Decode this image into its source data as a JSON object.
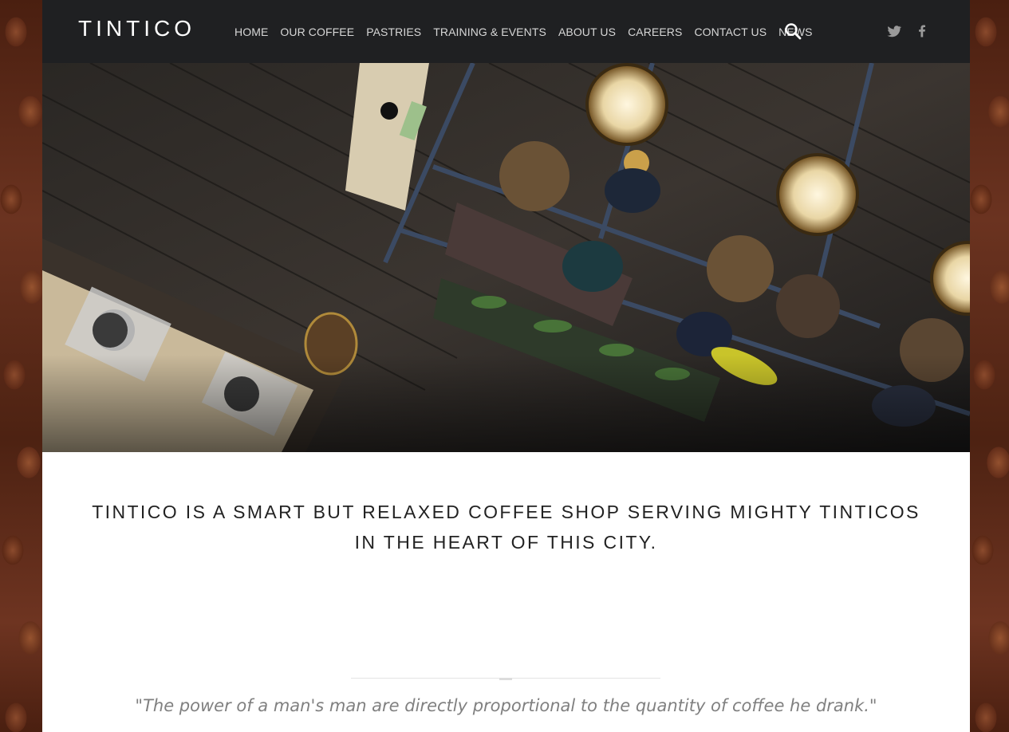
{
  "brand": {
    "logo_text": "TINTICO"
  },
  "nav": {
    "items": [
      "HOME",
      "OUR COFFEE",
      "PASTRIES",
      "TRAINING & EVENTS",
      "ABOUT US",
      "CAREERS",
      "CONTACT US",
      "NEWS"
    ]
  },
  "icons": {
    "search": "search-icon",
    "twitter": "twitter-icon",
    "facebook": "facebook-icon"
  },
  "tagline": {
    "line1": "TINTICO IS A SMART BUT RELAXED COFFEE SHOP SERVING MIGHTY TINTICOS",
    "line2": "IN THE HEART OF THIS CITY."
  },
  "quote": {
    "text": "\"The power of a man's man are directly proportional to the quantity of coffee he drank.\""
  },
  "colors": {
    "header_bg": "#1f2022",
    "nav_text": "#d7d7d7",
    "page_bg": "#ffffff",
    "quote_text": "#808080"
  }
}
